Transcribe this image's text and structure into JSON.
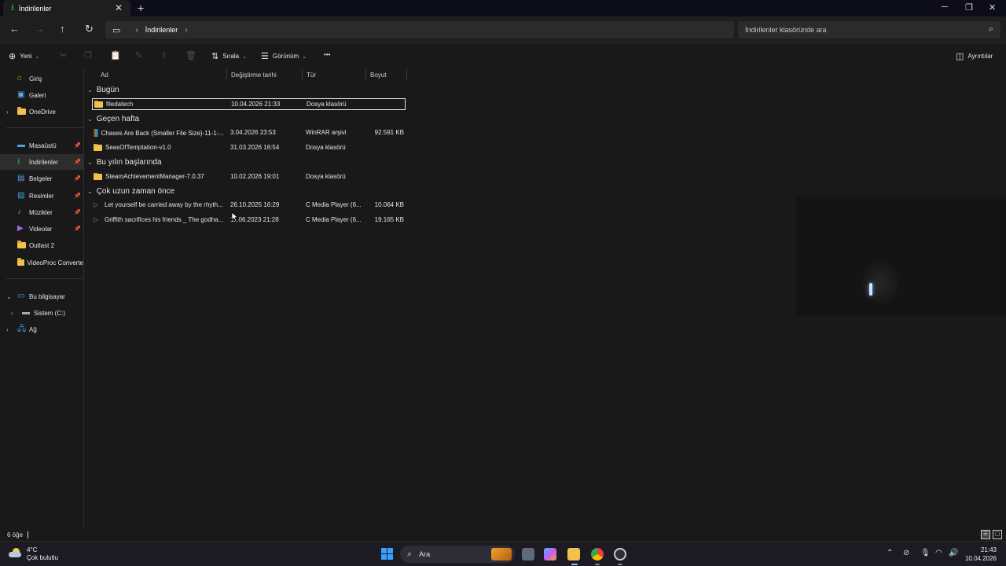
{
  "window": {
    "tab_title": "İndirilenler",
    "tab_close": "✕",
    "new_tab": "+",
    "minimize": "─",
    "maximize": "❐",
    "close": "✕"
  },
  "nav": {
    "breadcrumb": [
      "İndirilenler"
    ],
    "search_placeholder": "İndirilenler klasöründe ara"
  },
  "toolbar": {
    "new_label": "Yeni",
    "sort_label": "Sırala",
    "view_label": "Görünüm",
    "more_label": "•••",
    "details_label": "Ayrıntılar"
  },
  "sidebar": {
    "items": [
      {
        "label": "Giriş",
        "icon": "home-icon"
      },
      {
        "label": "Galeri",
        "icon": "gallery-icon"
      },
      {
        "label": "OneDrive",
        "icon": "folder-icon"
      },
      {
        "label": "Masaüstü",
        "icon": "desktop-icon",
        "pinned": true
      },
      {
        "label": "İndirilenler",
        "icon": "download-icon",
        "pinned": true
      },
      {
        "label": "Belgeler",
        "icon": "document-icon",
        "pinned": true
      },
      {
        "label": "Resimler",
        "icon": "pictures-icon",
        "pinned": true
      },
      {
        "label": "Müzikler",
        "icon": "music-icon",
        "pinned": true
      },
      {
        "label": "Videolar",
        "icon": "video-icon",
        "pinned": true
      },
      {
        "label": "Outlast 2",
        "icon": "folder-icon"
      },
      {
        "label": "VideoProc Converte",
        "icon": "folder-icon"
      },
      {
        "label": "Bu bilgisayar",
        "icon": "pc-icon"
      },
      {
        "label": "Sistem (C:)",
        "icon": "drive-icon"
      },
      {
        "label": "Ağ",
        "icon": "network-icon"
      }
    ]
  },
  "columns": {
    "name": "Ad",
    "date": "Değiştirme tarihi",
    "type": "Tür",
    "size": "Boyut"
  },
  "groups": [
    {
      "title": "Bugün"
    },
    {
      "title": "Geçen hafta"
    },
    {
      "title": "Bu yılın başlarında"
    },
    {
      "title": "Çok uzun zaman önce"
    }
  ],
  "files": [
    {
      "name": "filedatech",
      "date": "10.04.2026 21:33",
      "type": "Dosya klasörü",
      "size": ""
    },
    {
      "name": "Chases Are Back (Smaller File Size)-11-1-...",
      "date": "3.04.2026 23:53",
      "type": "WinRAR arşivi",
      "size": "92.591 KB"
    },
    {
      "name": "SeasOfTemptation-v1.0",
      "date": "31.03.2026 16:54",
      "type": "Dosya klasörü",
      "size": ""
    },
    {
      "name": "SteamAchievementManager-7.0.37",
      "date": "10.02.2026 19:01",
      "type": "Dosya klasörü",
      "size": ""
    },
    {
      "name": "Let yourself be carried away by the rhyth...",
      "date": "26.10.2025 16:29",
      "type": "C Media Player (6...",
      "size": "10.064 KB"
    },
    {
      "name": "Griffith sacrifices his friends _ The godha...",
      "date": "11.06.2023 21:28",
      "type": "C Media Player (6...",
      "size": "19.165 KB"
    }
  ],
  "status": {
    "item_count": "6 öğe"
  },
  "taskbar": {
    "temperature": "4°C",
    "weather": "Çok bulutlu",
    "search_label": "Ara",
    "time": "21:43",
    "date": "10.04.2026"
  },
  "colors": {
    "folder": "#f2c14e",
    "accent": "#3aa0ff",
    "download_green": "#2fae5b"
  }
}
